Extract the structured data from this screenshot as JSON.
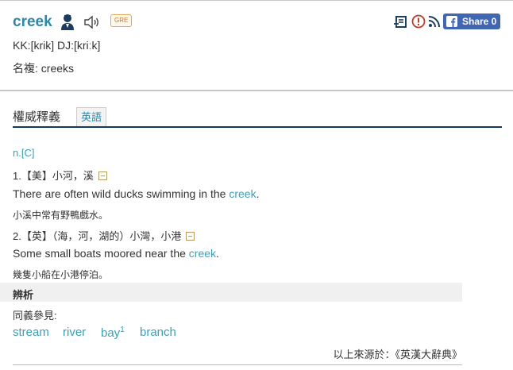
{
  "entry": {
    "headword": "creek",
    "badge": "GRE",
    "phonetic": "KK:[krik] DJ:[kriːk]",
    "plural": "名複: creeks",
    "icons": [
      "pronunciation-person-icon",
      "speaker-icon",
      "add-to-wordlist-icon",
      "report-error-icon",
      "rss-icon",
      "facebook-icon"
    ],
    "share_label": "Share 0"
  },
  "tabs": {
    "authority_label": "權威釋義",
    "english_label": "英語"
  },
  "definitions": {
    "pos": "n.[C]",
    "senses": [
      {
        "label": "1.【美】小河，溪",
        "example_before": "There are often wild ducks swimming in the ",
        "example_highlight": "creek",
        "example_after": ".",
        "translation": "小溪中常有野鴨戲水。"
      },
      {
        "label": "2.【英】（海，河，湖的）小灣，小港",
        "example_before": "Some small boats moored near the ",
        "example_highlight": "creek",
        "example_after": ".",
        "translation": "幾隻小船在小港停泊。"
      }
    ]
  },
  "analysis": {
    "title": "辨析",
    "synonyms_label": "同義參見:",
    "synonyms": [
      "stream",
      "river",
      "bay",
      "branch"
    ],
    "bay_sup": "1"
  },
  "source": "以上來源於：《英漢大辭典》",
  "colors": {
    "headword": "#2a8aa8",
    "link": "#3aa0b8",
    "tab_rule": "#123a66",
    "facebook": "#4267b2"
  }
}
